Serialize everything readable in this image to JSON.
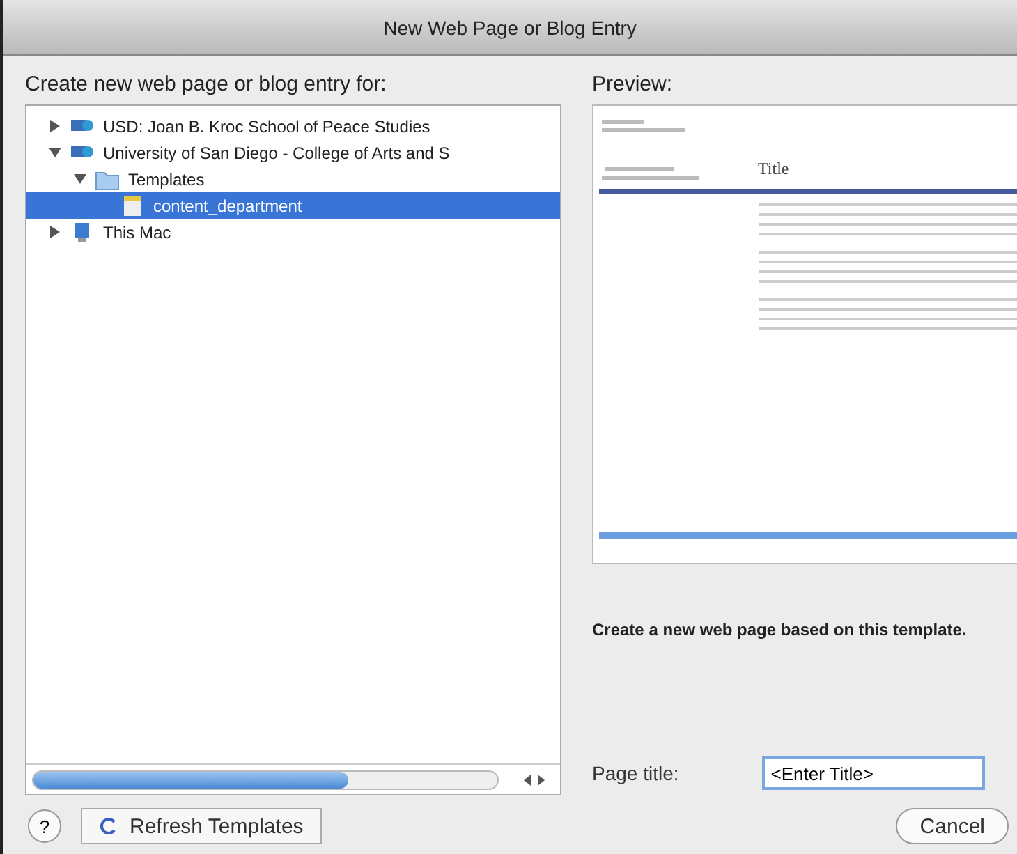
{
  "window": {
    "title": "New Web Page or Blog Entry"
  },
  "tree": {
    "label": "Create new web page or blog entry for:",
    "items": [
      {
        "kind": "site",
        "label": "USD: Joan B. Kroc School of Peace Studies",
        "expanded": false,
        "selected": false
      },
      {
        "kind": "site",
        "label": "University of San Diego - College of Arts and S",
        "expanded": true,
        "selected": false,
        "children": [
          {
            "kind": "folder",
            "label": "Templates",
            "expanded": true,
            "selected": false,
            "children": [
              {
                "kind": "template",
                "label": "content_department",
                "selected": true
              }
            ]
          }
        ]
      },
      {
        "kind": "computer",
        "label": "This Mac",
        "expanded": false,
        "selected": false
      }
    ]
  },
  "preview": {
    "label": "Preview:",
    "heading": "Title",
    "description": "Create a new web page based on this template."
  },
  "page_title": {
    "label": "Page title:",
    "value": "<Enter Title>"
  },
  "buttons": {
    "help": "?",
    "refresh": "Refresh Templates",
    "cancel": "Cancel"
  }
}
